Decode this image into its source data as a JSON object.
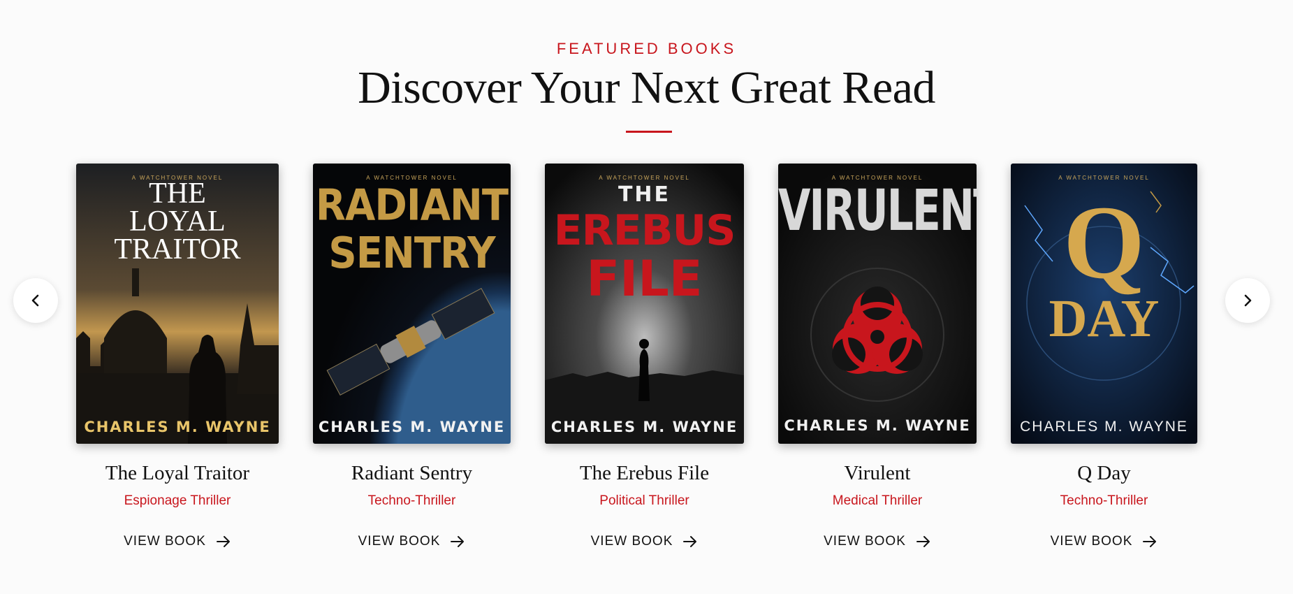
{
  "header": {
    "eyebrow": "FEATURED BOOKS",
    "title": "Discover Your Next Great Read"
  },
  "colors": {
    "accent": "#c8161d",
    "gold": "#c9a55a"
  },
  "nav": {
    "prev_icon": "chevron-left-icon",
    "next_icon": "chevron-right-icon"
  },
  "books": [
    {
      "series": "A WATCHTOWER NOVEL",
      "cover_title": [
        "THE",
        "LOYAL",
        "TRAITOR"
      ],
      "author": "CHARLES M. WAYNE",
      "title": "The Loyal Traitor",
      "genre": "Espionage Thriller",
      "action": "VIEW BOOK"
    },
    {
      "series": "A WATCHTOWER NOVEL",
      "cover_title": [
        "RADIANT",
        "SENTRY"
      ],
      "author": "CHARLES M. WAYNE",
      "title": "Radiant Sentry",
      "genre": "Techno-Thriller",
      "action": "VIEW BOOK"
    },
    {
      "series": "A WATCHTOWER NOVEL",
      "cover_title": [
        "THE",
        "EREBUS",
        "FILE"
      ],
      "author": "CHARLES M. WAYNE",
      "title": "The Erebus File",
      "genre": "Political Thriller",
      "action": "VIEW BOOK"
    },
    {
      "series": "A WATCHTOWER NOVEL",
      "cover_title": [
        "VIRULENT"
      ],
      "author": "CHARLES M. WAYNE",
      "title": "Virulent",
      "genre": "Medical Thriller",
      "action": "VIEW BOOK"
    },
    {
      "series": "A WATCHTOWER NOVEL",
      "cover_title": [
        "Q",
        "DAY"
      ],
      "author": "CHARLES M. WAYNE",
      "title": "Q Day",
      "genre": "Techno-Thriller",
      "action": "VIEW BOOK"
    }
  ]
}
